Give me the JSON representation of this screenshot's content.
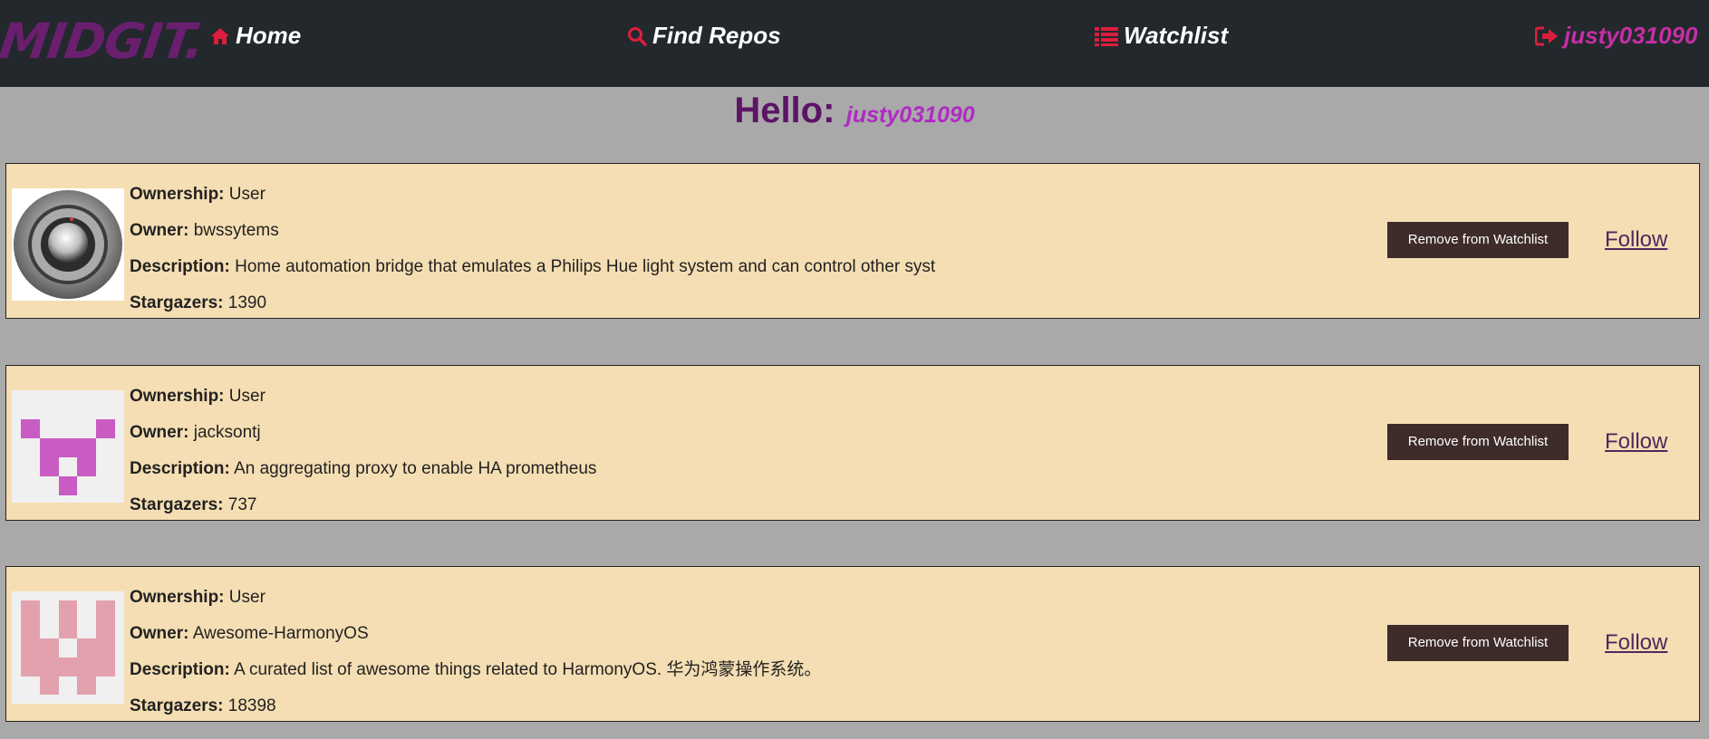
{
  "nav": {
    "logo": "MIDGIT.",
    "home": "Home",
    "find_repos": "Find Repos",
    "watchlist": "Watchlist",
    "user": "justy031090",
    "icon_color": "#dc1e3c"
  },
  "greeting": {
    "hello": "Hello:",
    "username": "justy031090"
  },
  "labels": {
    "ownership": "Ownership:",
    "owner": "Owner:",
    "description": "Description:",
    "stargazers": "Stargazers:"
  },
  "repos": [
    {
      "ownership": "User",
      "owner": "bwssytems",
      "description": "Home automation bridge that emulates a Philips Hue light system and can control other syst",
      "stargazers": "1390",
      "remove_label": "Remove from Watchlist",
      "follow_label": "Follow",
      "avatar": "knob-avatar"
    },
    {
      "ownership": "User",
      "owner": "jacksontj",
      "description": "An aggregating proxy to enable HA prometheus",
      "stargazers": "737",
      "remove_label": "Remove from Watchlist",
      "follow_label": "Follow",
      "avatar": "identicon-magenta"
    },
    {
      "ownership": "User",
      "owner": "Awesome-HarmonyOS",
      "description": "A curated list of awesome things related to HarmonyOS. 华为鸿蒙操作系统。",
      "stargazers": "18398",
      "remove_label": "Remove from Watchlist",
      "follow_label": "Follow",
      "avatar": "identicon-pink"
    }
  ]
}
